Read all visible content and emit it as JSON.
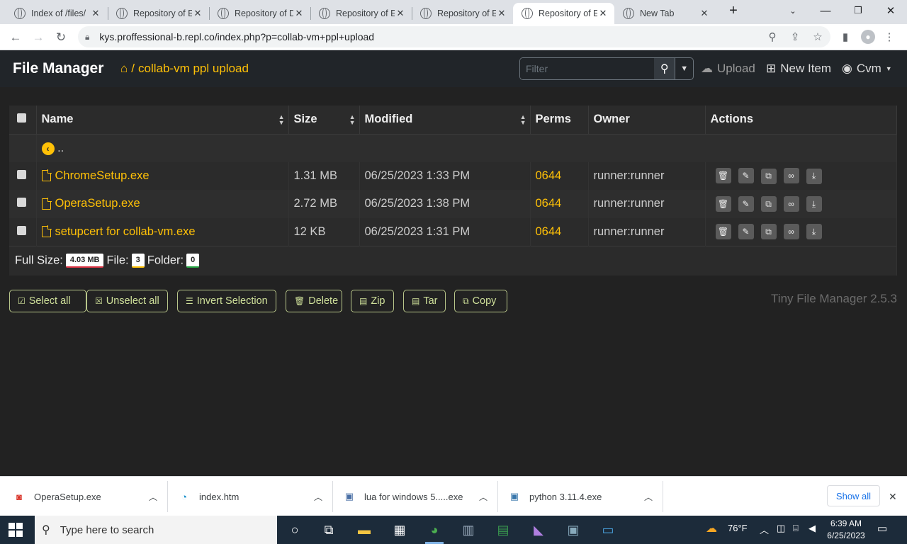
{
  "browser": {
    "tabs": [
      {
        "title": "Index of /files/"
      },
      {
        "title": "Repository of E"
      },
      {
        "title": "Repository of D"
      },
      {
        "title": "Repository of E"
      },
      {
        "title": "Repository of E"
      },
      {
        "title": "Repository of E"
      },
      {
        "title": "New Tab"
      }
    ],
    "url": "kys.proffessional-b.repl.co/index.php?p=collab-vm+ppl+upload"
  },
  "app": {
    "brand": "File Manager",
    "breadcrumb_sep": "/",
    "breadcrumb_path": "collab-vm ppl upload",
    "filter_placeholder": "Filter",
    "upload_label": "Upload",
    "new_item_label": "New Item",
    "user_label": "Cvm",
    "version": "Tiny File Manager 2.5.3"
  },
  "table": {
    "headers": {
      "name": "Name",
      "size": "Size",
      "modified": "Modified",
      "perms": "Perms",
      "owner": "Owner",
      "actions": "Actions"
    },
    "parent_label": "..",
    "rows": [
      {
        "name": "ChromeSetup.exe",
        "size": "1.31 MB",
        "modified": "06/25/2023 1:33 PM",
        "perms": "0644",
        "owner": "runner:runner"
      },
      {
        "name": "OperaSetup.exe",
        "size": "2.72 MB",
        "modified": "06/25/2023 1:38 PM",
        "perms": "0644",
        "owner": "runner:runner"
      },
      {
        "name": "setupcert for collab-vm.exe",
        "size": "12 KB",
        "modified": "06/25/2023 1:31 PM",
        "perms": "0644",
        "owner": "runner:runner"
      }
    ],
    "footer": {
      "full_size_label": "Full Size:",
      "full_size_value": "4.03 MB",
      "file_label": "File:",
      "file_value": "3",
      "folder_label": "Folder:",
      "folder_value": "0"
    }
  },
  "bulk_actions": {
    "select_all": "Select all",
    "unselect_all": "Unselect all",
    "invert": "Invert Selection",
    "delete": "Delete",
    "zip": "Zip",
    "tar": "Tar",
    "copy": "Copy"
  },
  "downloads": {
    "items": [
      {
        "name": "OperaSetup.exe"
      },
      {
        "name": "index.htm"
      },
      {
        "name": "lua for windows 5.....exe"
      },
      {
        "name": "python 3.11.4.exe"
      }
    ],
    "show_all": "Show all"
  },
  "taskbar": {
    "search_placeholder": "Type here to search",
    "temperature": "76°F",
    "time": "6:39 AM",
    "date": "6/25/2023"
  },
  "colors": {
    "accent": "#ffc107",
    "navbar": "#212529",
    "page_bg": "#222222",
    "button_border": "#b8c68a"
  }
}
